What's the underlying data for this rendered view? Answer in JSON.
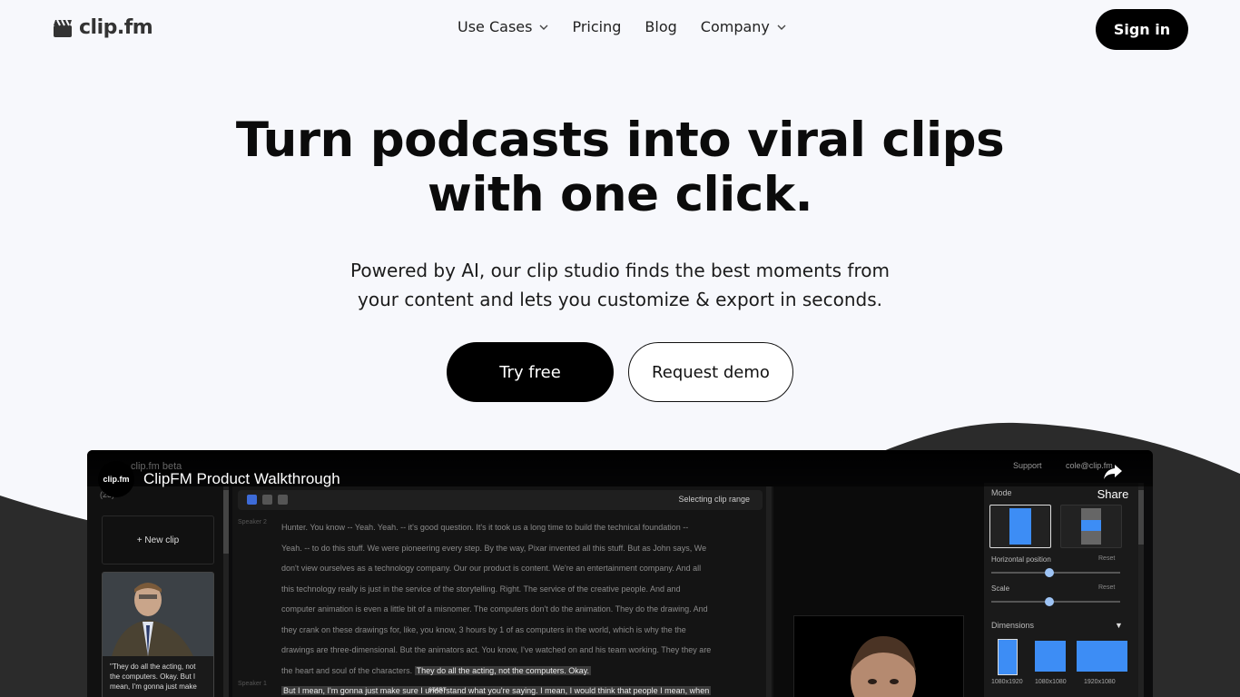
{
  "header": {
    "logo_text": "clip.fm",
    "nav": [
      {
        "label": "Use Cases",
        "dropdown": true
      },
      {
        "label": "Pricing",
        "dropdown": false
      },
      {
        "label": "Blog",
        "dropdown": false
      },
      {
        "label": "Company",
        "dropdown": true
      }
    ],
    "signin_label": "Sign in"
  },
  "hero": {
    "title_line1": "Turn podcasts into viral clips",
    "title_line2": "with one click.",
    "subtitle_line1": "Powered by AI, our clip studio finds the best moments from",
    "subtitle_line2": "your content and lets you customize & export in seconds.",
    "try_label": "Try free",
    "demo_label": "Request demo"
  },
  "video": {
    "channel_avatar_text": "clip.fm",
    "title": "ClipFM Product Walkthrough",
    "share_label": "Share",
    "app": {
      "brand": "clip.fm beta",
      "top_links": [
        "Support",
        "cole@clip.fm"
      ],
      "clip_count": "(23)",
      "new_clip_label": "+ New clip",
      "clip_quote": "\"They do all the acting, not the computers. Okay. But I mean, I'm gonna just make",
      "toolbar_status": "Selecting clip range",
      "speaker_a": "Speaker 2",
      "speaker_b": "Speaker 1",
      "start_tag": "START",
      "transcript": [
        "Hunter. You know -- Yeah. Yeah. -- it's good question. It's it took us a long time to build the technical foundation --",
        "Yeah. -- to do this stuff. We were pioneering every step. By the way, Pixar invented all this stuff. But as John says, We",
        "don't view ourselves as a technology company. Our our product is content. We're an entertainment company. And all",
        "this technology really is just in the service of the storytelling. Right. The service of the creative people. And and",
        "computer animation is even a little bit of a misnomer. The computers don't do the animation. They do the drawing. And",
        "they crank on these drawings for, like, you know, 3 hours by 1 of as computers in the world, which is why the the",
        "drawings are three-dimensional. But the animators act. You know, I've watched on and his team working. They they are",
        "the heart and soul of the characters."
      ],
      "highlight_a": "They do all the acting, not the computers. Okay.",
      "highlight_b": "But I mean, I'm gonna just make sure I understand what you're saying. I mean, I would think that people I mean, when",
      "panel": {
        "mode_label": "Mode",
        "hpos_label": "Horizontal position",
        "scale_label": "Scale",
        "reset_label": "Reset",
        "dimensions_label": "Dimensions",
        "dims": [
          "1080x1920",
          "1080x1080",
          "1920x1080"
        ],
        "hpos_value": 0.45,
        "scale_value": 0.45
      }
    }
  },
  "colors": {
    "page_bg": "#f7f8fc",
    "dark_wave": "#2b2b2b",
    "accent_blue": "#3d8df5",
    "primary_button": "#000000"
  }
}
